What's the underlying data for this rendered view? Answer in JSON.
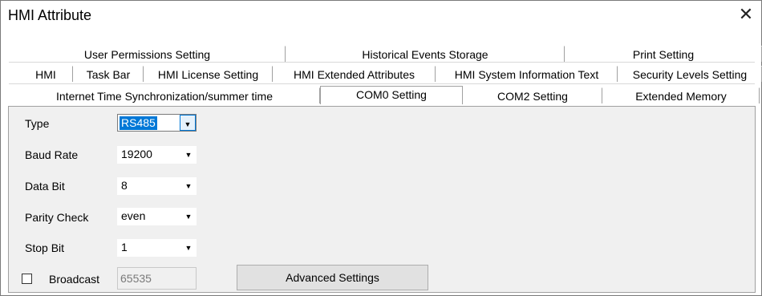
{
  "window": {
    "title": "HMI Attribute",
    "close_glyph": "✕"
  },
  "tabs": {
    "row1": [
      "User Permissions Setting",
      "Historical Events Storage",
      "Print Setting"
    ],
    "row2": [
      "HMI",
      "Task Bar",
      "HMI License Setting",
      "HMI Extended Attributes",
      "HMI System Information Text",
      "Security Levels Setting"
    ],
    "row3": [
      "Internet Time Synchronization/summer time",
      "COM0 Setting",
      "COM2 Setting",
      "Extended Memory"
    ],
    "active": "COM0 Setting"
  },
  "form": {
    "type": {
      "label": "Type",
      "value": "RS485"
    },
    "baud_rate": {
      "label": "Baud Rate",
      "value": "19200"
    },
    "data_bit": {
      "label": "Data Bit",
      "value": "8"
    },
    "parity_check": {
      "label": "Parity Check",
      "value": "even"
    },
    "stop_bit": {
      "label": "Stop Bit",
      "value": "1"
    },
    "broadcast": {
      "label": "Broadcast",
      "checked": false,
      "value": "65535"
    },
    "advanced_button": "Advanced Settings"
  },
  "icons": {
    "dropdown_arrow": "▼"
  }
}
